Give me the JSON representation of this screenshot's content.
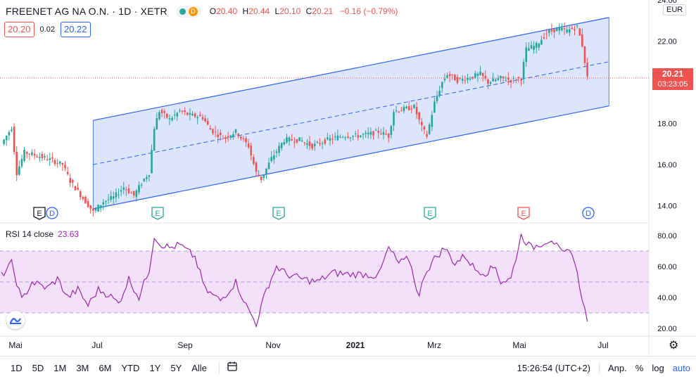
{
  "header": {
    "symbol": "FREENET AG NA O.N. · 1D · XETR",
    "ohlc": [
      {
        "k": "O",
        "v": "20.40"
      },
      {
        "k": "H",
        "v": "20.44"
      },
      {
        "k": "L",
        "v": "20.10"
      },
      {
        "k": "C",
        "v": "20.21"
      },
      {
        "k": "",
        "v": "−0.16 (−0.79%)"
      }
    ],
    "status_letter": "D"
  },
  "bid_ask": {
    "bid": "20.20",
    "spread": "0.02",
    "ask": "20.22"
  },
  "price_axis": {
    "currency": "EUR",
    "labels": [
      "24.00",
      "22.00",
      "20.00",
      "18.00",
      "16.00",
      "14.00"
    ],
    "current_price": "20.21",
    "countdown": "03:23:05"
  },
  "rsi": {
    "label": "RSI 14 close",
    "value": "23.63",
    "axis_labels": [
      "80.00",
      "60.00",
      "40.00",
      "20.00"
    ]
  },
  "time_axis": [
    "Mai",
    "Jul",
    "Sep",
    "Nov",
    "2021",
    "Mrz",
    "Mai",
    "Jul"
  ],
  "events": [
    {
      "type": "E",
      "color": "#131722"
    },
    {
      "type": "D",
      "color": "#2962ff"
    },
    {
      "type": "E",
      "color": "#26a69a"
    },
    {
      "type": "E",
      "color": "#26a69a"
    },
    {
      "type": "E",
      "color": "#26a69a"
    },
    {
      "type": "E",
      "color": "#ef5350"
    },
    {
      "type": "D",
      "color": "#2962ff"
    }
  ],
  "bottom_bar": {
    "ranges": [
      "1D",
      "5D",
      "1M",
      "3M",
      "6M",
      "YTD",
      "1Y",
      "5Y",
      "Alle"
    ],
    "compare_icon": "calendar-range-icon",
    "clock": "15:26:54 (UTC+2)",
    "adjust": "Anp.",
    "percent": "%",
    "log": "log",
    "auto": "auto"
  },
  "colors": {
    "up": "#26a69a",
    "down": "#ef5350",
    "channel_line": "#2962ff",
    "channel_fill": "#d6e0fb",
    "rsi_line": "#9c27b0",
    "rsi_band": "#f3e1fa"
  },
  "chart_data": {
    "type": "candlestick",
    "title": "FREENET AG NA O.N. · 1D · XETR",
    "x_tick_labels": [
      "Mai",
      "Jul",
      "Sep",
      "Nov",
      "2021",
      "Mrz",
      "Mai",
      "Jul"
    ],
    "ylim": [
      13.2,
      24.0
    ],
    "anchors": [
      [
        0,
        17.0
      ],
      [
        4,
        17.8
      ],
      [
        6,
        15.6
      ],
      [
        9,
        16.6
      ],
      [
        15,
        16.4
      ],
      [
        20,
        16.2
      ],
      [
        24,
        16.0
      ],
      [
        27,
        15.2
      ],
      [
        33,
        14.2
      ],
      [
        36,
        13.7
      ],
      [
        40,
        14.2
      ],
      [
        44,
        14.4
      ],
      [
        48,
        14.9
      ],
      [
        52,
        14.5
      ],
      [
        56,
        15.3
      ],
      [
        58,
        15.6
      ],
      [
        60,
        17.8
      ],
      [
        62,
        18.6
      ],
      [
        66,
        18.2
      ],
      [
        70,
        18.6
      ],
      [
        74,
        18.4
      ],
      [
        79,
        18.3
      ],
      [
        82,
        17.7
      ],
      [
        87,
        17.3
      ],
      [
        92,
        17.6
      ],
      [
        97,
        16.9
      ],
      [
        100,
        15.6
      ],
      [
        102,
        15.3
      ],
      [
        106,
        16.3
      ],
      [
        111,
        17.2
      ],
      [
        117,
        17.2
      ],
      [
        122,
        16.9
      ],
      [
        128,
        17.2
      ],
      [
        134,
        17.4
      ],
      [
        140,
        17.4
      ],
      [
        145,
        17.5
      ],
      [
        148,
        17.6
      ],
      [
        152,
        17.4
      ],
      [
        154,
        18.6
      ],
      [
        158,
        18.7
      ],
      [
        162,
        18.8
      ],
      [
        165,
        17.8
      ],
      [
        167,
        17.4
      ],
      [
        170,
        19.0
      ],
      [
        173,
        20.0
      ],
      [
        175,
        20.4
      ],
      [
        179,
        20.1
      ],
      [
        183,
        20.2
      ],
      [
        188,
        20.4
      ],
      [
        191,
        20.0
      ],
      [
        196,
        20.2
      ],
      [
        200,
        20.1
      ],
      [
        204,
        20.2
      ],
      [
        206,
        21.6
      ],
      [
        210,
        21.8
      ],
      [
        214,
        22.4
      ],
      [
        218,
        22.6
      ],
      [
        222,
        22.5
      ],
      [
        226,
        22.7
      ],
      [
        228,
        21.8
      ],
      [
        230,
        20.21
      ]
    ],
    "rsi_anchors": [
      [
        0,
        54
      ],
      [
        4,
        62
      ],
      [
        8,
        38
      ],
      [
        12,
        50
      ],
      [
        18,
        46
      ],
      [
        22,
        52
      ],
      [
        26,
        40
      ],
      [
        30,
        45
      ],
      [
        34,
        35
      ],
      [
        38,
        45
      ],
      [
        42,
        42
      ],
      [
        46,
        36
      ],
      [
        50,
        52
      ],
      [
        54,
        40
      ],
      [
        58,
        58
      ],
      [
        60,
        80
      ],
      [
        62,
        75
      ],
      [
        66,
        72
      ],
      [
        70,
        74
      ],
      [
        76,
        66
      ],
      [
        80,
        45
      ],
      [
        86,
        38
      ],
      [
        92,
        50
      ],
      [
        96,
        35
      ],
      [
        100,
        23
      ],
      [
        104,
        45
      ],
      [
        108,
        60
      ],
      [
        112,
        55
      ],
      [
        118,
        52
      ],
      [
        124,
        50
      ],
      [
        130,
        56
      ],
      [
        136,
        55
      ],
      [
        142,
        55
      ],
      [
        148,
        54
      ],
      [
        152,
        72
      ],
      [
        156,
        62
      ],
      [
        160,
        65
      ],
      [
        164,
        40
      ],
      [
        166,
        55
      ],
      [
        170,
        65
      ],
      [
        174,
        72
      ],
      [
        178,
        62
      ],
      [
        182,
        67
      ],
      [
        186,
        58
      ],
      [
        190,
        56
      ],
      [
        194,
        60
      ],
      [
        196,
        50
      ],
      [
        200,
        52
      ],
      [
        204,
        80
      ],
      [
        208,
        72
      ],
      [
        212,
        75
      ],
      [
        216,
        78
      ],
      [
        220,
        68
      ],
      [
        224,
        70
      ],
      [
        226,
        55
      ],
      [
        228,
        40
      ],
      [
        230,
        23.63
      ]
    ],
    "rsi_bands": [
      30,
      50,
      70
    ],
    "channel": {
      "start_index": 36,
      "end_index": 244,
      "mid_start": 16.0,
      "mid_end": 21.0,
      "half_width": 2.15
    }
  }
}
